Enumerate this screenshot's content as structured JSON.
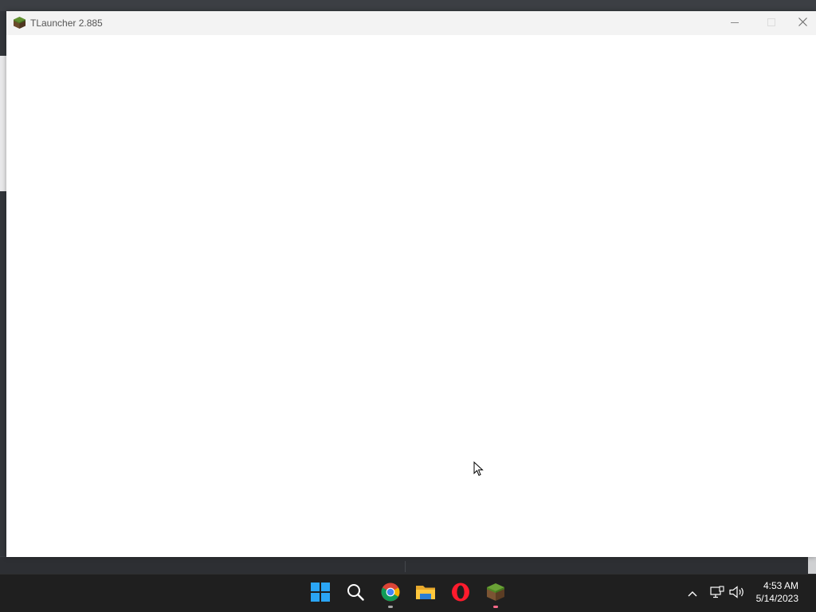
{
  "window": {
    "title": "TLauncher 2.885",
    "app_icon": "tlauncher-grass-block-icon",
    "controls": {
      "minimize_icon": "minimize-icon",
      "maximize_icon": "maximize-icon",
      "close_icon": "close-icon"
    }
  },
  "taskbar": {
    "apps": [
      {
        "name": "Start",
        "icon": "windows-start-icon"
      },
      {
        "name": "Search",
        "icon": "search-icon"
      },
      {
        "name": "Google Chrome",
        "icon": "chrome-icon",
        "running": true
      },
      {
        "name": "File Explorer",
        "icon": "folder-icon"
      },
      {
        "name": "Opera",
        "icon": "opera-icon"
      },
      {
        "name": "TLauncher",
        "icon": "tlauncher-grass-block-icon",
        "running": true,
        "active": true
      }
    ],
    "tray": {
      "overflow_icon": "chevron-up-icon",
      "network_icon": "network-icon",
      "volume_icon": "volume-icon"
    },
    "clock": {
      "time": "4:53 AM",
      "date": "5/14/2023"
    }
  },
  "colors": {
    "taskbar_bg": "#1f1f1f",
    "titlebar_bg": "#f3f3f3",
    "window_bg": "#ffffff",
    "indicator_active": "#ff6a8a",
    "indicator_running": "#a5a5a5"
  }
}
